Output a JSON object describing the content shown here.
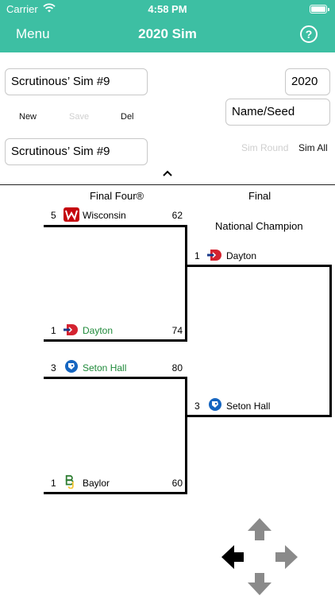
{
  "status": {
    "carrier": "Carrier",
    "time": "4:58 PM"
  },
  "nav": {
    "menu_label": "Menu",
    "title": "2020 Sim",
    "help_glyph": "?"
  },
  "controls": {
    "sim_name_field": "Scrutinous’ Sim #9",
    "year_field": "2020",
    "new_label": "New",
    "save_label": "Save",
    "del_label": "Del",
    "name_seed_field": "Name/Seed",
    "sim_select_field": "Scrutinous’ Sim #9",
    "sim_round_label": "Sim Round",
    "sim_all_label": "Sim All"
  },
  "bracket": {
    "final_four_heading": "Final Four®",
    "final_heading": "Final",
    "champion_heading": "National Champion",
    "semifinals": [
      {
        "seed": "5",
        "team": "Wisconsin",
        "score": "62",
        "logo": "wisconsin-logo",
        "color": "#c5050c"
      },
      {
        "seed": "1",
        "team": "Dayton",
        "score": "74",
        "logo": "dayton-logo",
        "color": "#1f8a3a"
      },
      {
        "seed": "3",
        "team": "Seton Hall",
        "score": "80",
        "logo": "seton-hall-logo",
        "color": "#1f8a3a"
      },
      {
        "seed": "1",
        "team": "Baylor",
        "score": "60",
        "logo": "baylor-logo",
        "color": "#000000"
      }
    ],
    "finalists": [
      {
        "seed": "1",
        "team": "Dayton",
        "logo": "dayton-logo"
      },
      {
        "seed": "3",
        "team": "Seton Hall",
        "logo": "seton-hall-logo"
      }
    ]
  },
  "arrows": [
    "arrow-up-icon",
    "arrow-left-icon",
    "arrow-right-icon",
    "arrow-down-icon"
  ],
  "colors": {
    "accent": "#3dbfa3",
    "winner_text": "#1f8a3a",
    "disabled_text": "#cfcfcf"
  }
}
